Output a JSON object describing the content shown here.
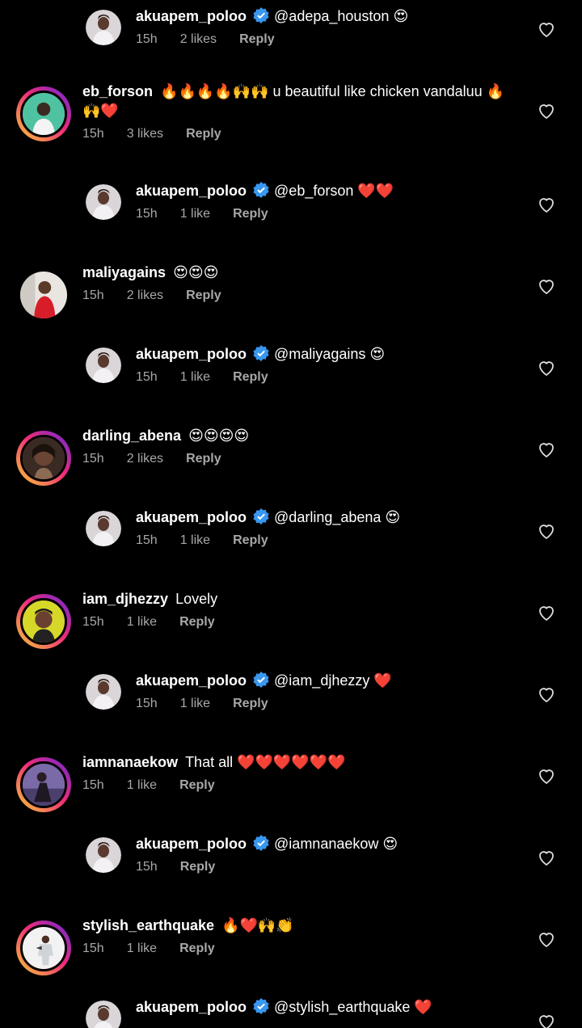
{
  "colors": {
    "background": "#000000",
    "text": "#ffffff",
    "meta": "#a8a8a8",
    "verified": "#3897f0",
    "story_ring": "#ee2a7b"
  },
  "comments": [
    {
      "kind": "reply",
      "user": "akuapem_poloo",
      "verified": true,
      "mention": "@adepa_houston",
      "emoji": "😍",
      "time": "15h",
      "likes": "2 likes",
      "reply": "Reply",
      "avatar": "poloo"
    },
    {
      "kind": "top",
      "user": "eb_forson",
      "text": "🔥🔥🔥🔥🙌🙌 u beautiful like chicken vandaluu 🔥🙌❤️",
      "time": "15h",
      "likes": "3 likes",
      "reply": "Reply",
      "ring": true,
      "avatar": "ebforson"
    },
    {
      "kind": "reply",
      "user": "akuapem_poloo",
      "verified": true,
      "mention": "@eb_forson",
      "emoji": "❤️❤️",
      "time": "15h",
      "likes": "1 like",
      "reply": "Reply",
      "avatar": "poloo"
    },
    {
      "kind": "top",
      "user": "maliyagains",
      "text": "😍😍😍",
      "time": "15h",
      "likes": "2 likes",
      "reply": "Reply",
      "ring": false,
      "avatar": "maliya"
    },
    {
      "kind": "reply",
      "user": "akuapem_poloo",
      "verified": true,
      "mention": "@maliyagains",
      "emoji": "😍",
      "time": "15h",
      "likes": "1 like",
      "reply": "Reply",
      "avatar": "poloo"
    },
    {
      "kind": "top",
      "user": "darling_abena",
      "text": "😍😍😍😍",
      "time": "15h",
      "likes": "2 likes",
      "reply": "Reply",
      "ring": true,
      "avatar": "abena"
    },
    {
      "kind": "reply",
      "user": "akuapem_poloo",
      "verified": true,
      "mention": "@darling_abena",
      "emoji": "😍",
      "time": "15h",
      "likes": "1 like",
      "reply": "Reply",
      "avatar": "poloo"
    },
    {
      "kind": "top",
      "user": "iam_djhezzy",
      "text": "Lovely",
      "time": "15h",
      "likes": "1 like",
      "reply": "Reply",
      "ring": true,
      "avatar": "djhezzy"
    },
    {
      "kind": "reply",
      "user": "akuapem_poloo",
      "verified": true,
      "mention": "@iam_djhezzy",
      "emoji": "❤️",
      "time": "15h",
      "likes": "1 like",
      "reply": "Reply",
      "avatar": "poloo"
    },
    {
      "kind": "top",
      "user": "iamnanaekow",
      "text": "That all ❤️❤️❤️❤️❤️❤️",
      "time": "15h",
      "likes": "1 like",
      "reply": "Reply",
      "ring": true,
      "avatar": "nanaekow"
    },
    {
      "kind": "reply",
      "user": "akuapem_poloo",
      "verified": true,
      "mention": "@iamnanaekow",
      "emoji": "😍",
      "time": "15h",
      "likes": "",
      "reply": "Reply",
      "avatar": "poloo"
    },
    {
      "kind": "top",
      "user": "stylish_earthquake",
      "text": "🔥❤️🙌👏",
      "time": "15h",
      "likes": "1 like",
      "reply": "Reply",
      "ring": true,
      "avatar": "earthquake"
    },
    {
      "kind": "reply",
      "user": "akuapem_poloo",
      "verified": true,
      "mention": "@stylish_earthquake",
      "emoji": "❤️",
      "time": "",
      "likes": "",
      "reply": "",
      "avatar": "poloo"
    }
  ]
}
